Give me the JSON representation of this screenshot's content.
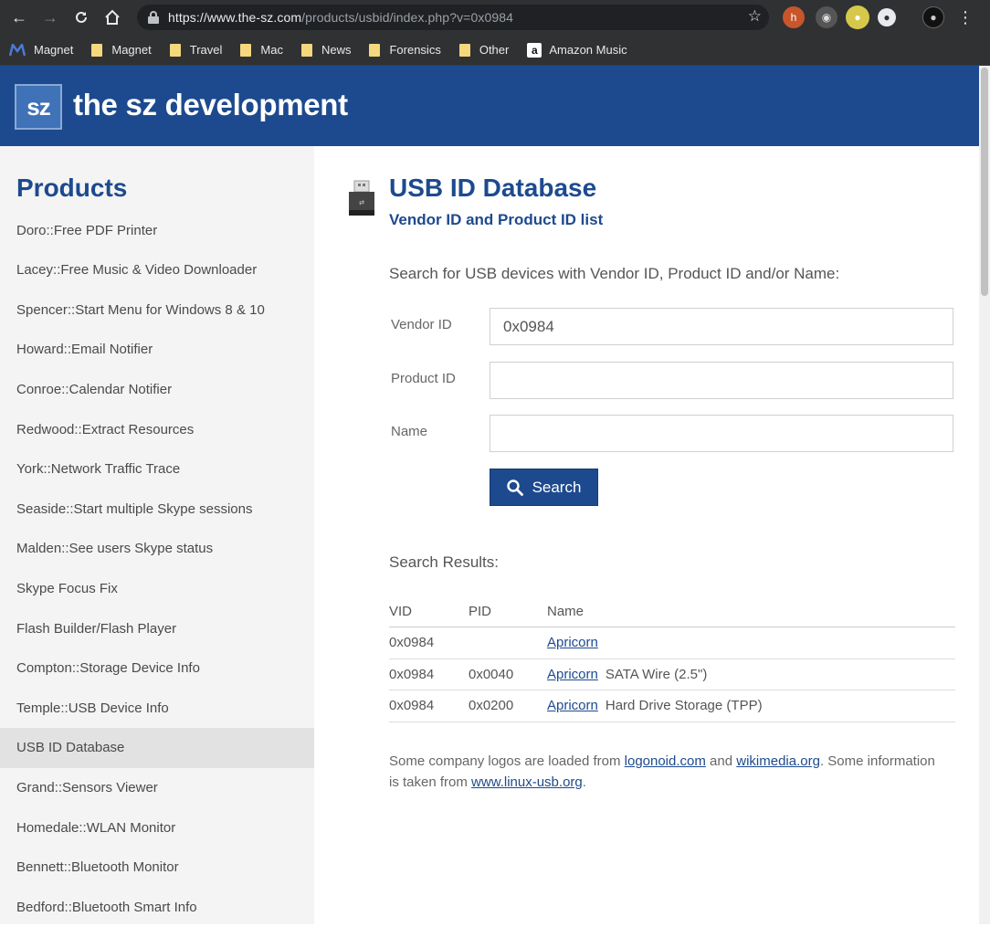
{
  "browser": {
    "url_host": "https://www.the-sz.com",
    "url_path": "/products/usbid/index.php?v=0x0984",
    "bookmarks": [
      "Magnet",
      "Magnet",
      "Travel",
      "Mac",
      "News",
      "Forensics",
      "Other",
      "Amazon Music"
    ]
  },
  "site": {
    "logo_text": "sz",
    "title": "the sz development"
  },
  "sidebar": {
    "heading": "Products",
    "items": [
      "Doro::Free PDF Printer",
      "Lacey::Free Music & Video Downloader",
      "Spencer::Start Menu for Windows 8 & 10",
      "Howard::Email Notifier",
      "Conroe::Calendar Notifier",
      "Redwood::Extract Resources",
      "York::Network Traffic Trace",
      "Seaside::Start multiple Skype sessions",
      "Malden::See users Skype status",
      "Skype Focus Fix",
      "Flash Builder/Flash Player",
      "Compton::Storage Device Info",
      "Temple::USB Device Info",
      "USB ID Database",
      "Grand::Sensors Viewer",
      "Homedale::WLAN Monitor",
      "Bennett::Bluetooth Monitor",
      "Bedford::Bluetooth Smart Info"
    ],
    "active": "USB ID Database"
  },
  "main": {
    "title": "USB ID Database",
    "subtitle": "Vendor ID and Product ID list",
    "search_intro": "Search for USB devices with Vendor ID, Product ID and/or Name:",
    "form": {
      "vendor_label": "Vendor ID",
      "vendor_value": "0x0984",
      "product_label": "Product ID",
      "product_value": "",
      "name_label": "Name",
      "name_value": "",
      "search_button": "Search"
    },
    "results_title": "Search Results:",
    "table": {
      "headers": [
        "VID",
        "PID",
        "Name"
      ],
      "rows": [
        {
          "vid": "0x0984",
          "pid": "",
          "name": "Apricorn",
          "desc": ""
        },
        {
          "vid": "0x0984",
          "pid": "0x0040",
          "name": "Apricorn",
          "desc": "SATA Wire (2.5\")"
        },
        {
          "vid": "0x0984",
          "pid": "0x0200",
          "name": "Apricorn",
          "desc": "Hard Drive Storage (TPP)"
        }
      ]
    },
    "footnote": {
      "t1": "Some company logos are loaded from ",
      "link1": "logonoid.com",
      "t2": " and ",
      "link2": "wikimedia.org",
      "t3": ". Some information is taken from ",
      "link3": "www.linux-usb.org",
      "t4": "."
    }
  },
  "colors": {
    "brand_blue": "#1d4a8e",
    "chrome_dark": "#2f3133",
    "sidebar_bg": "#f4f4f4"
  }
}
